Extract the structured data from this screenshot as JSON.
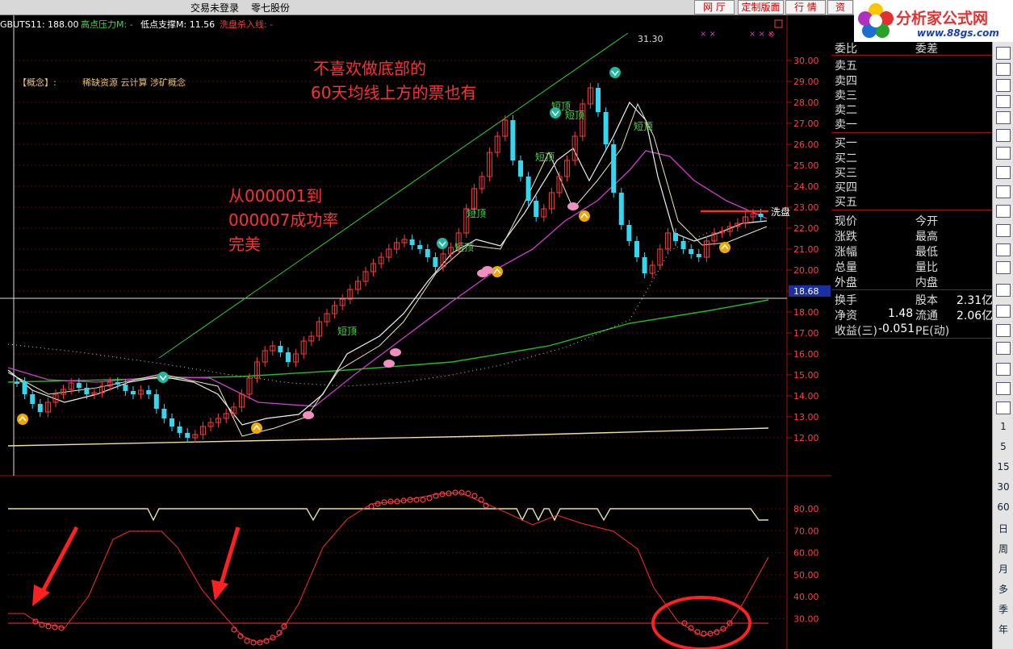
{
  "topbar": {
    "login_status": "交易未登录",
    "stock_name": "零七股份",
    "buttons": [
      "网 厅",
      "定制版面",
      "行 情",
      "资"
    ]
  },
  "logo": {
    "brand": "分析家公式网",
    "url": "www.88gs.com"
  },
  "indicator_line": {
    "code": "GBUTS11: 188.00",
    "high_pressure": "高点压力M: -",
    "low_support": "低点支撑M: 11.56",
    "wash_line": "洗盘杀入线: -"
  },
  "concept": {
    "label": "【概念】:",
    "tags": "稀缺资源 云计算 涉矿概念"
  },
  "annotations": {
    "a1_line1": "不喜欢做底部的",
    "a1_line2": "60天均线上方的票也有",
    "a2_line1": "从000001到",
    "a2_line2": "000007成功率",
    "a2_line3": "完美"
  },
  "chart_labels": {
    "peak_value": "31.30",
    "current_price_tag": "18.68",
    "wash_label": "洗盘",
    "short_top": "短顶"
  },
  "price_axis": [
    "30.00",
    "29.00",
    "28.00",
    "27.00",
    "26.00",
    "25.00",
    "24.00",
    "23.00",
    "22.00",
    "21.00",
    "20.00",
    "19.00",
    "18.00",
    "17.00",
    "16.00",
    "15.00",
    "14.00",
    "13.00",
    "12.00"
  ],
  "osc_axis": [
    "80.00",
    "70.00",
    "60.00",
    "50.00",
    "40.00",
    "30.00"
  ],
  "quote_panel": {
    "header_left": "委比",
    "header_right": "委差",
    "sell": [
      "卖五",
      "卖四",
      "卖三",
      "卖二",
      "卖一"
    ],
    "buy": [
      "买一",
      "买二",
      "买三",
      "买四",
      "买五"
    ],
    "stats": [
      {
        "l1": "现价",
        "l2": "今开"
      },
      {
        "l1": "涨跌",
        "l2": "最高"
      },
      {
        "l1": "涨幅",
        "l2": "最低"
      },
      {
        "l1": "总量",
        "l2": "量比"
      },
      {
        "l1": "外盘",
        "l2": "内盘"
      }
    ],
    "turnover_label": "换手",
    "share_capital_label": "股本",
    "share_capital_value": "2.31亿",
    "net_asset_label": "净资",
    "net_asset_value": "1.48",
    "float_label": "流通",
    "float_value": "2.06亿",
    "eps_label": "收益(三)",
    "eps_value": "-0.051",
    "pe_label": "PE(动)"
  },
  "toolbar": {
    "period_labels": [
      "1",
      "5",
      "15",
      "30",
      "60",
      "日",
      "周",
      "月",
      "多",
      "季",
      "年"
    ]
  }
}
